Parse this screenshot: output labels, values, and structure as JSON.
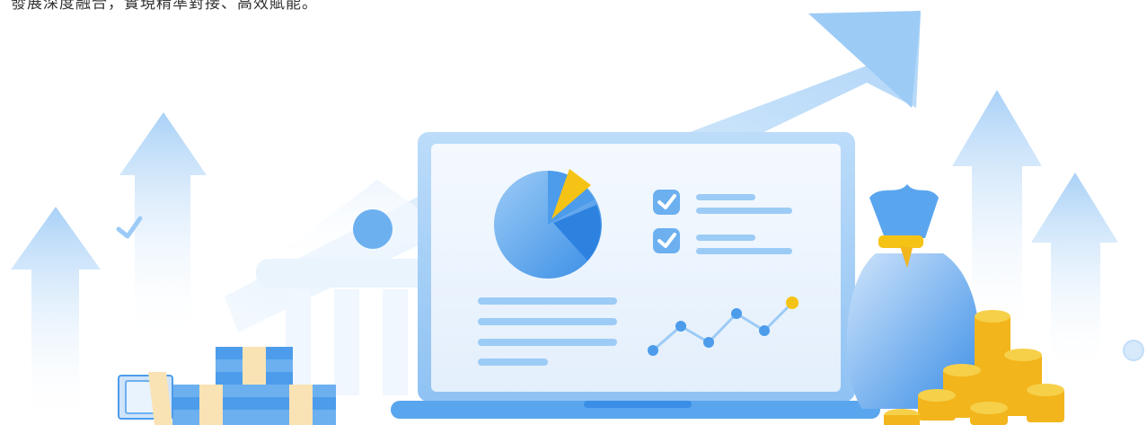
{
  "intro_text": "發展深度融合，實現精準對接、高效賦能。",
  "illustration": {
    "subject": "finance-laptop-illustration",
    "laptop_screen": {
      "pie_chart": {
        "slices": [
          0.62,
          0.27,
          0.11
        ]
      },
      "checklist_items": 2,
      "line_chart_points": [
        0.15,
        0.45,
        0.2,
        0.6,
        0.35,
        0.85
      ]
    },
    "colors": {
      "primary_blue": "#3a8ee6",
      "light_blue": "#9cc8f5",
      "pale_blue": "#d9ebfc",
      "gold": "#f5c315",
      "coin_gold": "#f2b51c"
    }
  }
}
